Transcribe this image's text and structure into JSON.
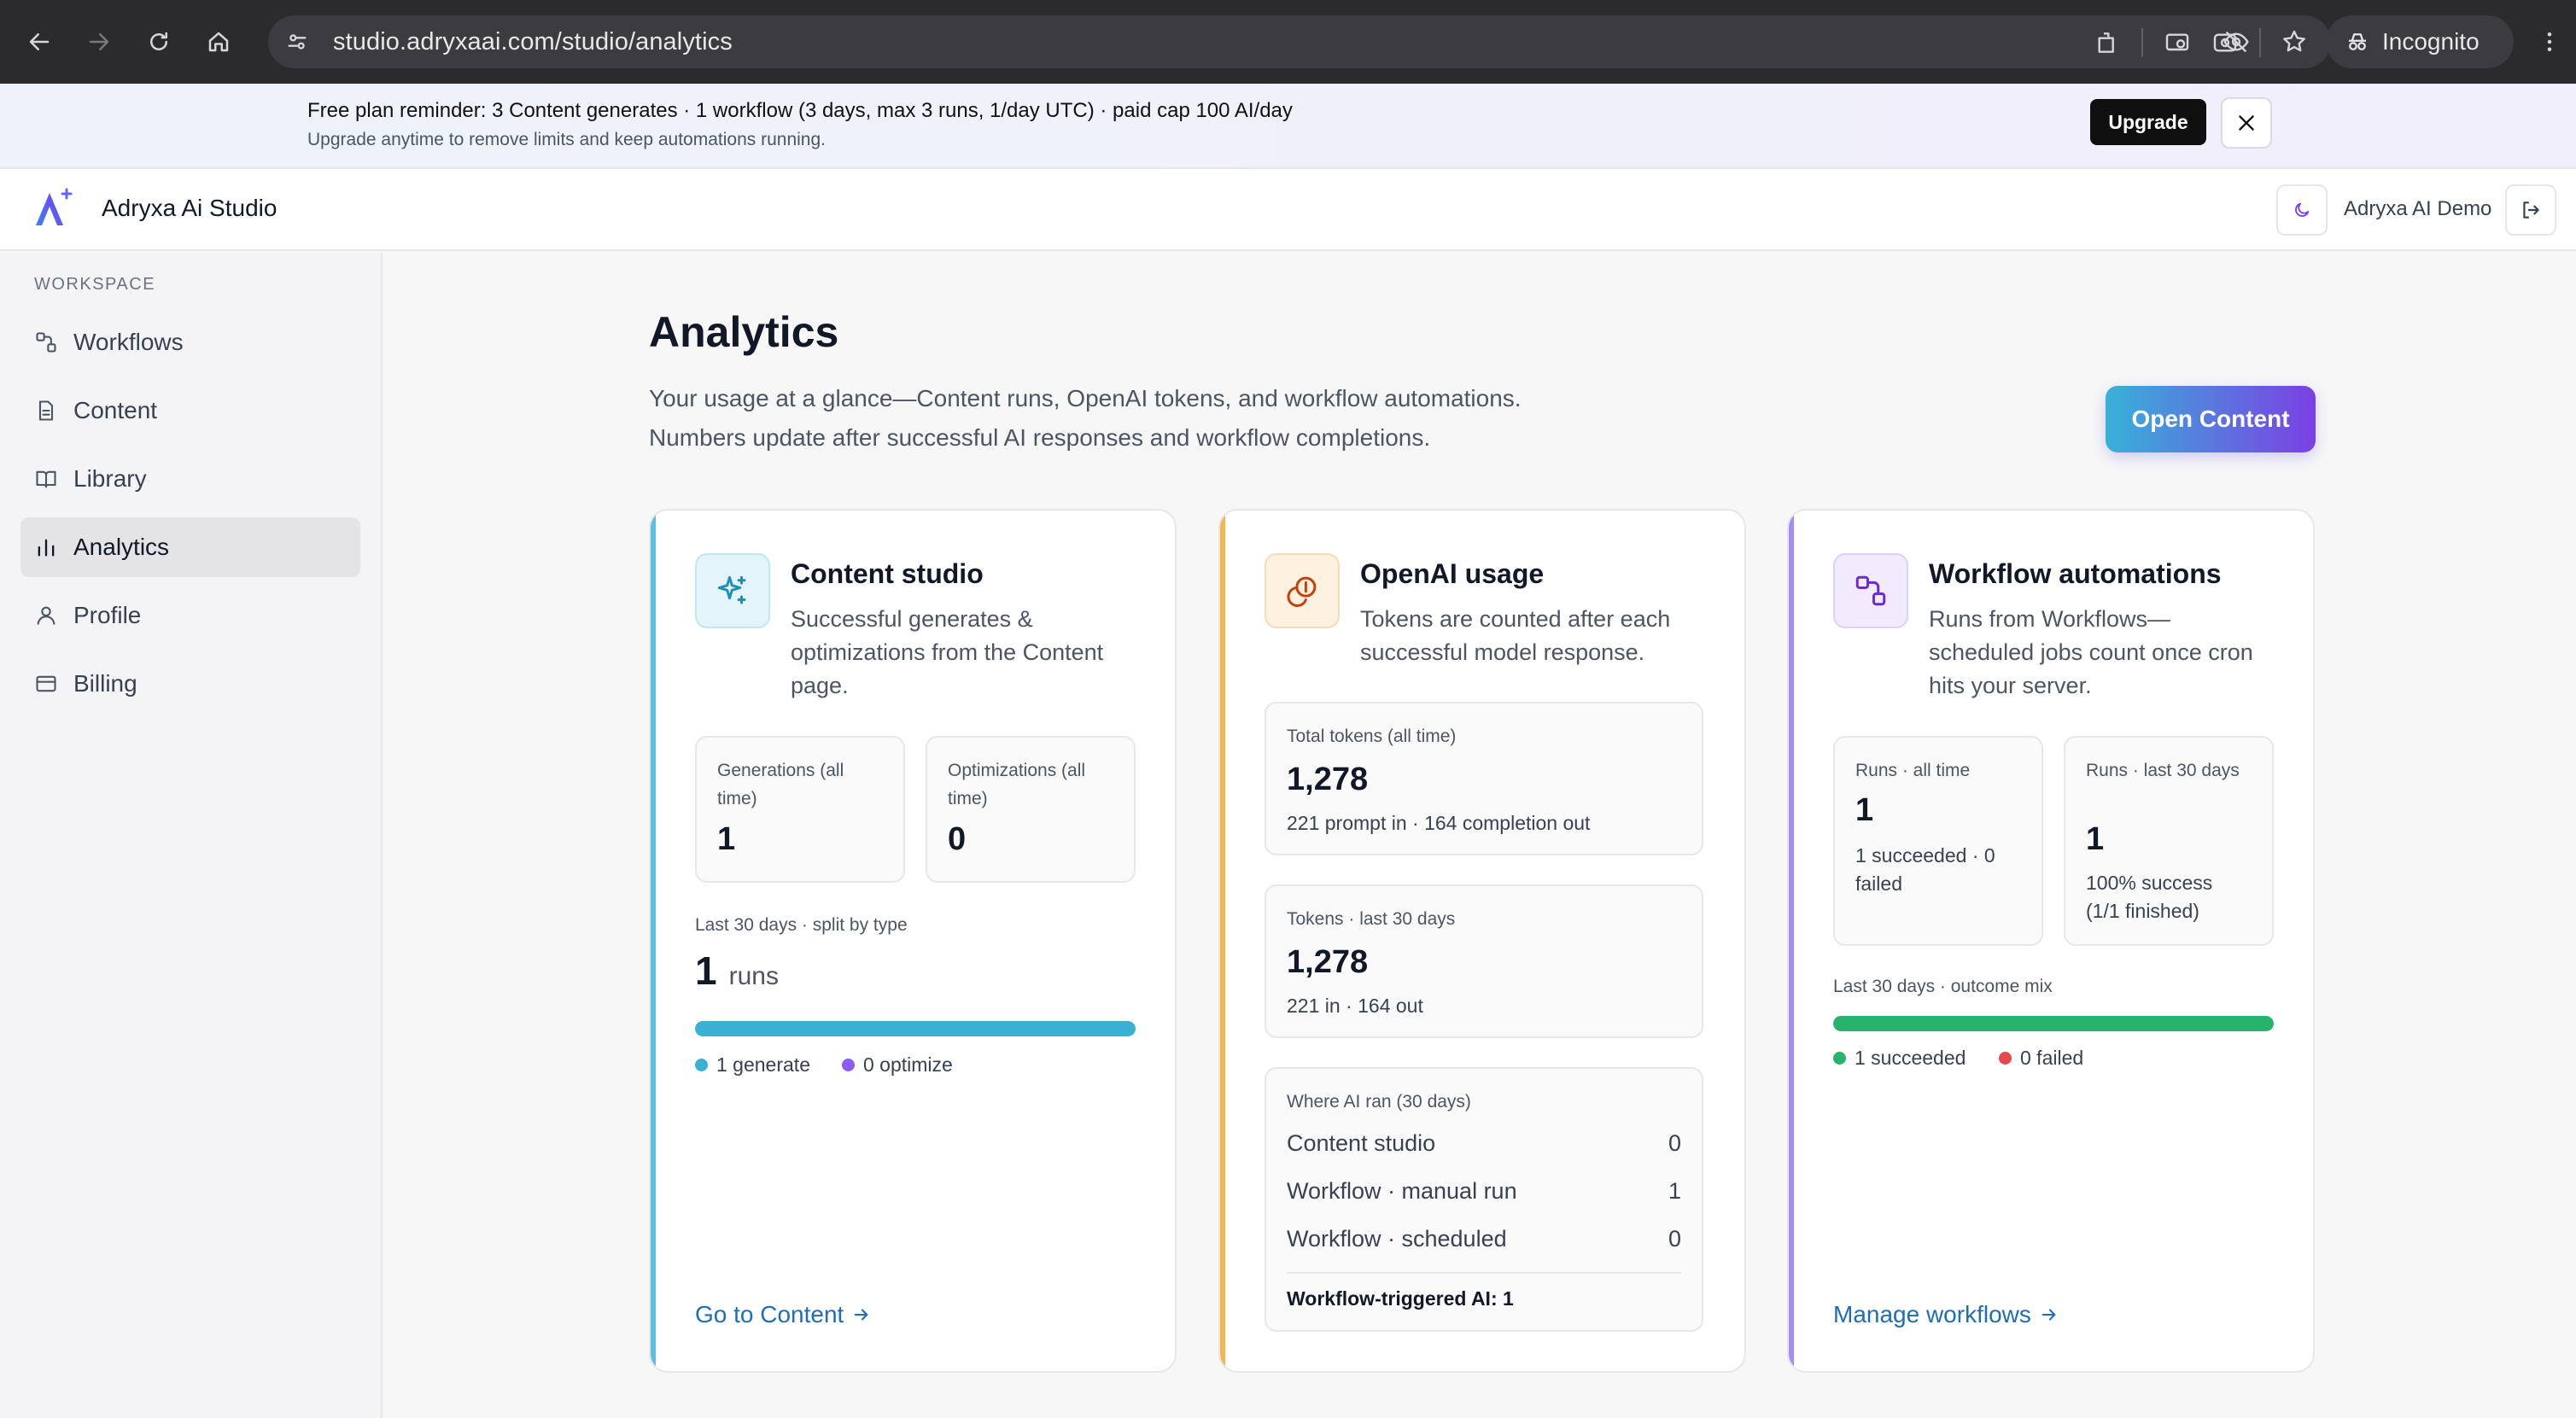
{
  "browser": {
    "url": "studio.adryxaai.com/studio/analytics",
    "profile_label": "Incognito"
  },
  "banner": {
    "line1": "Free plan reminder: 3 Content generates · 1 workflow (3 days, max 3 runs, 1/day UTC) · paid cap 100 AI/day",
    "line2": "Upgrade anytime to remove limits and keep automations running.",
    "upgrade_label": "Upgrade"
  },
  "header": {
    "brand": "Adryxa Ai Studio",
    "user_name": "Adryxa AI Demo"
  },
  "sidebar": {
    "section": "WORKSPACE",
    "items": [
      {
        "label": "Workflows",
        "icon": "workflow-icon",
        "active": false
      },
      {
        "label": "Content",
        "icon": "document-icon",
        "active": false
      },
      {
        "label": "Library",
        "icon": "book-icon",
        "active": false
      },
      {
        "label": "Analytics",
        "icon": "bar-chart-icon",
        "active": true
      },
      {
        "label": "Profile",
        "icon": "user-icon",
        "active": false
      },
      {
        "label": "Billing",
        "icon": "credit-card-icon",
        "active": false
      }
    ]
  },
  "page": {
    "title": "Analytics",
    "subtitle_1": "Your usage at a glance—Content runs, OpenAI tokens, and workflow automations.",
    "subtitle_2": "Numbers update after successful AI responses and workflow completions.",
    "open_content_label": "Open Content"
  },
  "content_card": {
    "title": "Content studio",
    "desc": "Successful generates & optimizations from the Content page.",
    "generations_label": "Generations (all time)",
    "generations_value": "1",
    "optimizations_label": "Optimizations (all time)",
    "optimizations_value": "0",
    "split_label": "Last 30 days · split by type",
    "runs_value": "1",
    "runs_unit": "runs",
    "generate_share": 1.0,
    "legend_generate": "1 generate",
    "legend_optimize": "0 optimize",
    "link": "Go to Content",
    "accent": "#5bc0de"
  },
  "openai_card": {
    "title": "OpenAI usage",
    "desc": "Tokens are counted after each successful model response.",
    "total_label": "Total tokens (all time)",
    "total_value": "1,278",
    "total_sub": "221 prompt in · 164 completion out",
    "last30_label": "Tokens · last 30 days",
    "last30_value": "1,278",
    "last30_sub": "221 in · 164 out",
    "where_label": "Where AI ran (30 days)",
    "where_rows": [
      {
        "label": "Content studio",
        "value": "0"
      },
      {
        "label": "Workflow · manual run",
        "value": "1"
      },
      {
        "label": "Workflow · scheduled",
        "value": "0"
      }
    ],
    "footer": "Workflow-triggered AI: 1",
    "accent": "#f2b84b"
  },
  "workflow_card": {
    "title": "Workflow automations",
    "desc": "Runs from Workflows—scheduled jobs count once cron hits your server.",
    "all_time_label": "Runs · all time",
    "all_time_value": "1",
    "all_time_sub": "1 succeeded · 0 failed",
    "last30_label": "Runs · last 30 days",
    "last30_value": "1",
    "last30_sub": "100% success (1/1 finished)",
    "mix_label": "Last 30 days · outcome mix",
    "success_share": 1.0,
    "legend_succeeded": "1 succeeded",
    "legend_failed": "0 failed",
    "link": "Manage workflows",
    "accent": "#a78bfa"
  },
  "colors": {
    "generate": "#3bb0d3",
    "optimize": "#8b5cf6",
    "succeeded": "#27b36b",
    "failed": "#e5484d"
  }
}
